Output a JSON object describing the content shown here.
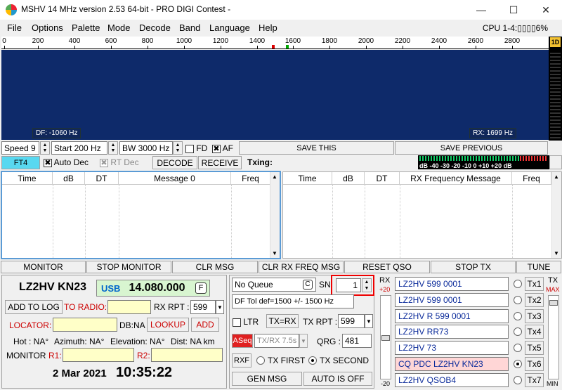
{
  "window": {
    "title": "MSHV 14 MHz version 2.53 64-bit  - PRO DIGI Contest -",
    "min": "—",
    "max": "☐",
    "close": "✕"
  },
  "menu": [
    "File",
    "Options",
    "Palette",
    "Mode",
    "Decode",
    "Band",
    "Language",
    "Help"
  ],
  "cpu": "CPU 1-4:▯▯▯▯6%",
  "ruler": {
    "labels": [
      "0",
      "200",
      "400",
      "600",
      "800",
      "1000",
      "1200",
      "1400",
      "1600",
      "1800",
      "2000",
      "2200",
      "2400",
      "2600",
      "2800"
    ],
    "max": 3000
  },
  "waterfall": {
    "df": "DF: -1060 Hz",
    "rx": "RX: 1699 Hz",
    "side_label": "1D"
  },
  "controls": {
    "speed": "Speed 9",
    "start": "Start 200 Hz",
    "bw": "BW 3000 Hz",
    "fd": "FD",
    "af": "AF",
    "save_this": "SAVE THIS",
    "save_prev": "SAVE PREVIOUS"
  },
  "mode_row": {
    "mode": "FT4",
    "auto_dec": "Auto Dec",
    "rt_dec": "RT Dec",
    "decode": "DECODE",
    "receive": "RECEIVE",
    "txing": "Txing:"
  },
  "meter": {
    "scale": "dB  -40  -30  -20  -10   0  +10 +20 dB"
  },
  "left_table": {
    "headers": [
      "Time",
      "dB",
      "DT",
      "Message 0",
      "Freq"
    ]
  },
  "right_table": {
    "headers": [
      "Time",
      "dB",
      "DT",
      "RX Frequency Message",
      "Freq"
    ]
  },
  "big_buttons": [
    "MONITOR",
    "STOP MONITOR",
    "CLR MSG",
    "CLR RX FREQ MSG",
    "RESET QSO",
    "STOP TX",
    "TUNE"
  ],
  "station": {
    "call_loc": "LZ2HV KN23",
    "freq_mode": "USB",
    "freq": "14.080.000",
    "f_btn": "F",
    "add_log": "ADD TO LOG",
    "to_radio": "TO RADIO:",
    "rx_rpt_lbl": "RX RPT :",
    "rx_rpt": "599",
    "locator": "LOCATOR:",
    "db_na": "DB:NA",
    "lookup": "LOOKUP",
    "add": "ADD",
    "hot": "Hot : NA°",
    "azimuth": "Azimuth: NA°",
    "elevation": "Elevation: NA°",
    "dist": "Dist: NA km",
    "monitor": "MONITOR",
    "r1": "R1:",
    "r2": "R2:",
    "date": "2 Mar 2021",
    "time": "10:35:22"
  },
  "queue": {
    "queue": "No Queue",
    "c_btn": "C",
    "sn_lbl": "SN:",
    "sn": "1",
    "df_tol": "DF Tol def=1500 +/-  1500  Hz",
    "ltr": "LTR",
    "tx_eq_rx": "TX=RX",
    "tx_rpt_lbl": "TX RPT :",
    "tx_rpt": "599",
    "aseq": "ASeq",
    "txrx": "TX/RX 7.5s",
    "qrg_lbl": "QRG :",
    "qrg": "481",
    "rxf": "RXF",
    "tx_first": "TX FIRST",
    "tx_second": "TX SECOND",
    "gen_msg": "GEN MSG",
    "auto_off": "AUTO IS OFF"
  },
  "rx_slider": {
    "label": "RX",
    "top": "+20",
    "bottom": "-20"
  },
  "tx_slider": {
    "label": "TX",
    "max": "MAX",
    "min": "MIN"
  },
  "tx_msgs": [
    {
      "text": "LZ2HV 599 0001",
      "btn": "Tx1"
    },
    {
      "text": "LZ2HV 599 0001",
      "btn": "Tx2"
    },
    {
      "text": "LZ2HV R 599 0001",
      "btn": "Tx3"
    },
    {
      "text": "LZ2HV RR73",
      "btn": "Tx4"
    },
    {
      "text": "LZ2HV 73",
      "btn": "Tx5"
    },
    {
      "text": "CQ PDC LZ2HV KN23",
      "btn": "Tx6"
    },
    {
      "text": "LZ2HV QSOB4",
      "btn": "Tx7"
    }
  ],
  "colors": {
    "waterfall": "#0e2a6a",
    "accent": "#5b9bd5",
    "freq_bg": "#d8f5d0",
    "cq_bg": "#ffd6d6",
    "aseq": "#e02020"
  }
}
